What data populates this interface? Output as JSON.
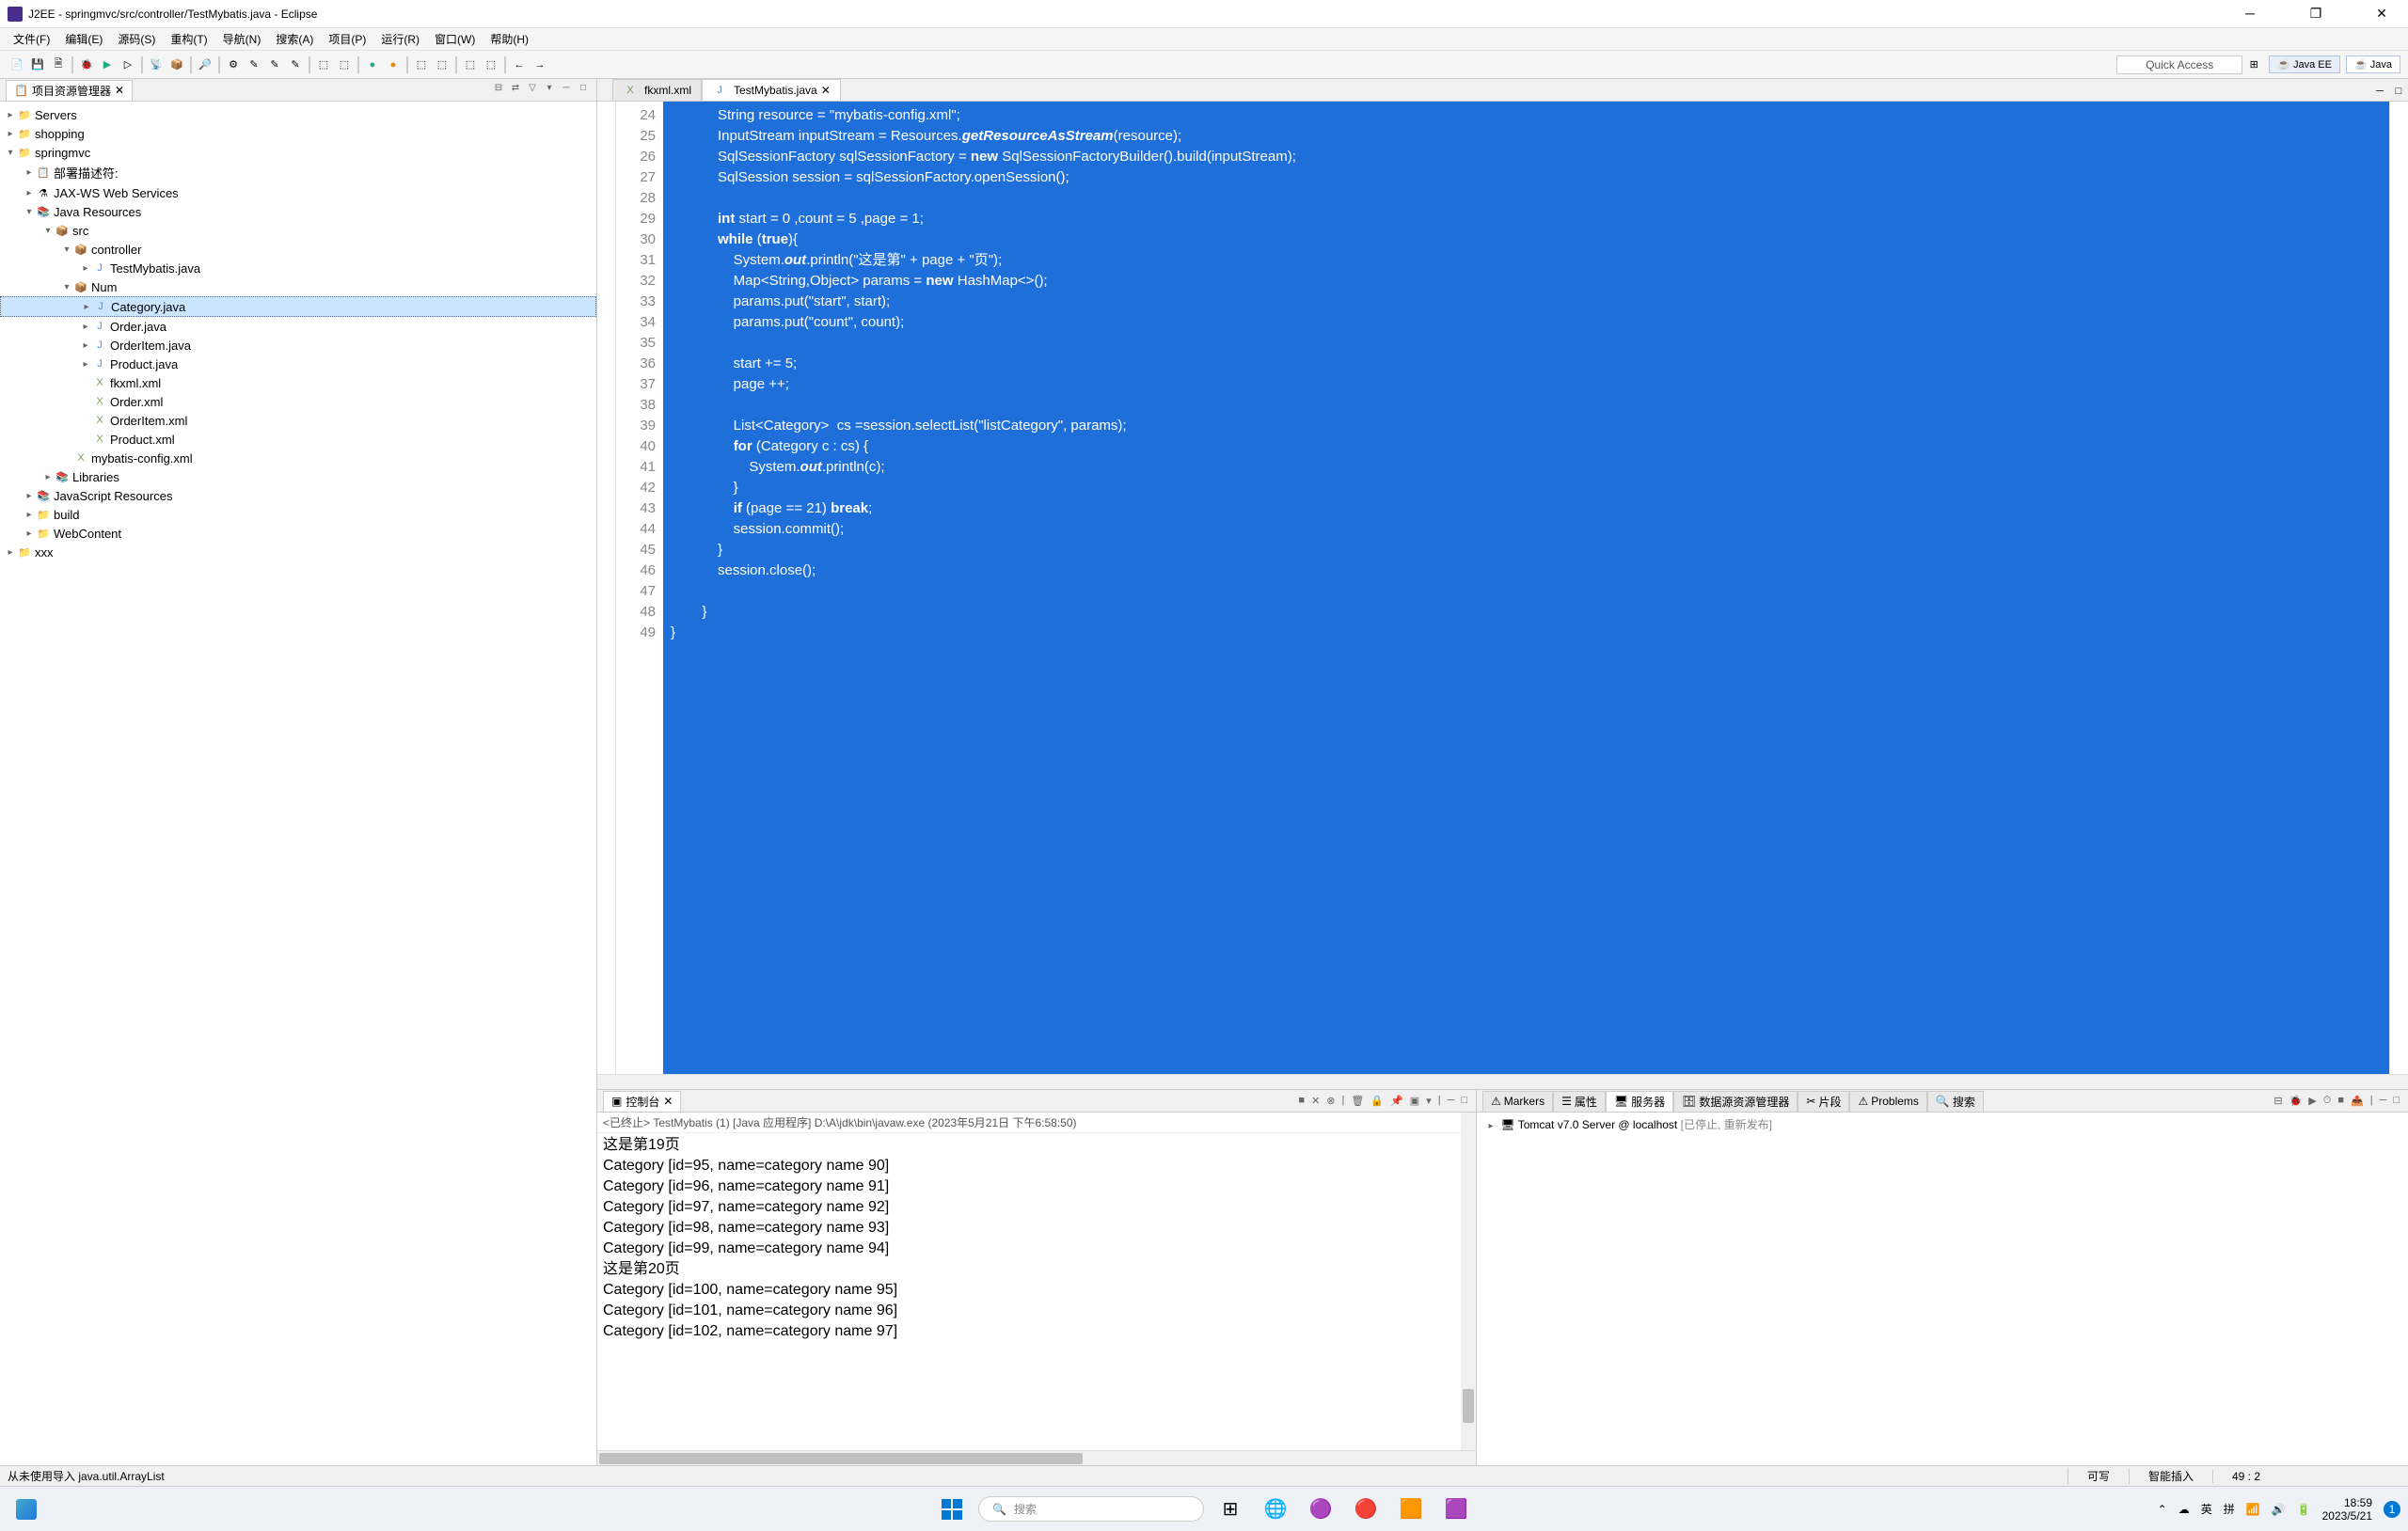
{
  "title": "J2EE - springmvc/src/controller/TestMybatis.java - Eclipse",
  "menus": [
    "文件(F)",
    "编辑(E)",
    "源码(S)",
    "重构(T)",
    "导航(N)",
    "搜索(A)",
    "项目(P)",
    "运行(R)",
    "窗口(W)",
    "帮助(H)"
  ],
  "quick_access": "Quick Access",
  "perspectives": [
    "Java EE",
    "Java"
  ],
  "project_explorer_title": "项目资源管理器",
  "tree": {
    "servers": "Servers",
    "shopping": "shopping",
    "springmvc": "springmvc",
    "deploy_desc": "部署描述符:",
    "jaxws": "JAX-WS Web Services",
    "java_res": "Java Resources",
    "src": "src",
    "controller": "controller",
    "testmybatis": "TestMybatis.java",
    "num": "Num",
    "category": "Category.java",
    "order": "Order.java",
    "orderitem": "OrderItem.java",
    "product": "Product.java",
    "fkxml": "fkxml.xml",
    "orderxml": "Order.xml",
    "orderitemxml": "OrderItem.xml",
    "productxml": "Product.xml",
    "mybatisconfig": "mybatis-config.xml",
    "libraries": "Libraries",
    "js_res": "JavaScript Resources",
    "build": "build",
    "webcontent": "WebContent",
    "xxx": "xxx"
  },
  "editor_tabs": {
    "tab1": "fkxml.xml",
    "tab2": "TestMybatis.java"
  },
  "code_lines": [
    {
      "n": 24,
      "t": "            String resource = \"mybatis-config.xml\";"
    },
    {
      "n": 25,
      "t": "            InputStream inputStream = Resources.getResourceAsStream(resource);"
    },
    {
      "n": 26,
      "t": "            SqlSessionFactory sqlSessionFactory = new SqlSessionFactoryBuilder().build(inputStream);"
    },
    {
      "n": 27,
      "t": "            SqlSession session = sqlSessionFactory.openSession();"
    },
    {
      "n": 28,
      "t": ""
    },
    {
      "n": 29,
      "t": "            int start = 0 ,count = 5 ,page = 1;"
    },
    {
      "n": 30,
      "t": "            while (true){"
    },
    {
      "n": 31,
      "t": "                System.out.println(\"这是第\" + page + \"页\");"
    },
    {
      "n": 32,
      "t": "                Map<String,Object> params = new HashMap<>();"
    },
    {
      "n": 33,
      "t": "                params.put(\"start\", start);"
    },
    {
      "n": 34,
      "t": "                params.put(\"count\", count);"
    },
    {
      "n": 35,
      "t": ""
    },
    {
      "n": 36,
      "t": "                start += 5;"
    },
    {
      "n": 37,
      "t": "                page ++;"
    },
    {
      "n": 38,
      "t": ""
    },
    {
      "n": 39,
      "t": "                List<Category>  cs =session.selectList(\"listCategory\", params);"
    },
    {
      "n": 40,
      "t": "                for (Category c : cs) {"
    },
    {
      "n": 41,
      "t": "                    System.out.println(c);"
    },
    {
      "n": 42,
      "t": "                }"
    },
    {
      "n": 43,
      "t": "                if (page == 21) break;"
    },
    {
      "n": 44,
      "t": "                session.commit();"
    },
    {
      "n": 45,
      "t": "            }"
    },
    {
      "n": 46,
      "t": "            session.close();"
    },
    {
      "n": 47,
      "t": ""
    },
    {
      "n": 48,
      "t": "        }"
    },
    {
      "n": 49,
      "t": "}"
    }
  ],
  "console": {
    "title": "控制台",
    "info": "<已终止> TestMybatis (1) [Java 应用程序] D:\\A\\jdk\\bin\\javaw.exe (2023年5月21日 下午6:58:50)",
    "lines": [
      "这是第19页",
      "Category [id=95, name=category name 90]",
      "Category [id=96, name=category name 91]",
      "Category [id=97, name=category name 92]",
      "Category [id=98, name=category name 93]",
      "Category [id=99, name=category name 94]",
      "这是第20页",
      "Category [id=100, name=category name 95]",
      "Category [id=101, name=category name 96]",
      "Category [id=102, name=category name 97]"
    ]
  },
  "servers_panel": {
    "tabs": [
      "Markers",
      "属性",
      "服务器",
      "数据源资源管理器",
      "片段",
      "Problems",
      "搜索"
    ],
    "server_name": "Tomcat v7.0 Server @ localhost",
    "server_status": "[已停止, 重新发布]"
  },
  "statusbar": {
    "msg": "从未使用导入 java.util.ArrayList",
    "writable": "可写",
    "insert": "智能插入",
    "pos": "49 : 2"
  },
  "taskbar": {
    "search": "搜索",
    "ime1": "英",
    "ime2": "拼",
    "time": "18:59",
    "date": "2023/5/21"
  }
}
